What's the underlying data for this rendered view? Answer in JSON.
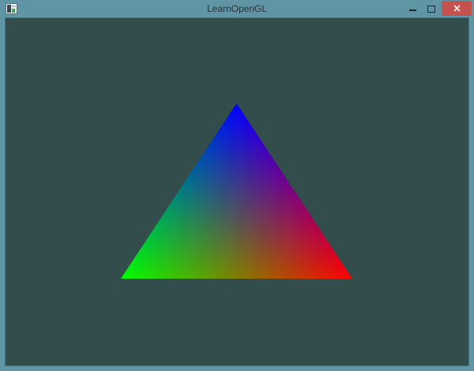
{
  "window": {
    "title": "LearnOpenGL",
    "controls": {
      "minimize": "minimize",
      "maximize": "maximize",
      "close": "close"
    }
  },
  "icons": {
    "app_icon": "application-window-icon",
    "minimize_icon": "minimize-dash",
    "maximize_icon": "maximize-square-outline",
    "close_icon": "close-x"
  },
  "colors": {
    "titlebar_bg": "#5f95a4",
    "border": "#5f95a4",
    "inner_edge": "#48737e",
    "client_bg": "#334d4d",
    "title_text": "#2e2e38",
    "control_glyph": "#20242c",
    "close_bg": "#c4524f",
    "close_glyph": "#ffffff",
    "triangle_red": "#ff0000",
    "triangle_green": "#00ff00",
    "triangle_blue": "#0000ff"
  },
  "scene": {
    "triangle_vertex_colors": {
      "top": "#0000ff",
      "bottom_left": "#00ff00",
      "bottom_right": "#ff0000"
    }
  }
}
